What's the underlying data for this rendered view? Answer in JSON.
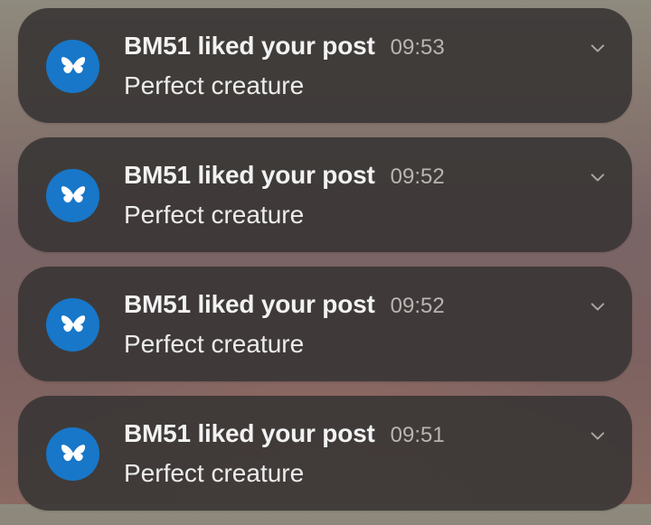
{
  "notifications": [
    {
      "app_icon": "bluesky-butterfly-icon",
      "title": "BM51 liked your post",
      "time": "09:53",
      "message": "Perfect creature"
    },
    {
      "app_icon": "bluesky-butterfly-icon",
      "title": "BM51 liked your post",
      "time": "09:52",
      "message": "Perfect creature"
    },
    {
      "app_icon": "bluesky-butterfly-icon",
      "title": "BM51 liked your post",
      "time": "09:52",
      "message": "Perfect creature"
    },
    {
      "app_icon": "bluesky-butterfly-icon",
      "title": "BM51 liked your post",
      "time": "09:51",
      "message": "Perfect creature"
    }
  ],
  "colors": {
    "card_background": "#3a3736",
    "icon_background": "#1877c8",
    "title_text": "#f2f2f2",
    "time_text": "#b9b5b2"
  },
  "expand_icon": "chevron-down-icon"
}
